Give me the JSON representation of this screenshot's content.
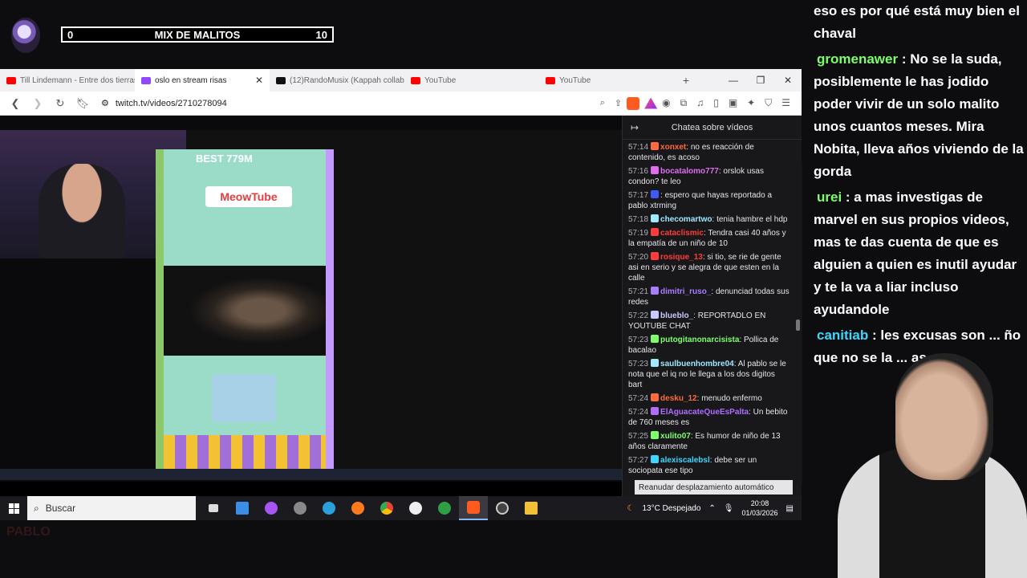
{
  "overlay": {
    "counter_left": "0",
    "counter_title": "MIX DE MALITOS",
    "counter_right": "10"
  },
  "browser": {
    "tabs": [
      {
        "label": "Till Lindemann - Entre dos tierras",
        "favicon_color": "#ff0000",
        "active": false
      },
      {
        "label": "oslo en stream risas",
        "favicon_color": "#9146ff",
        "active": true
      },
      {
        "label": "(12)RandoMusix (Kappah collab)",
        "favicon_color": "#111111",
        "active": false
      },
      {
        "label": "YouTube",
        "favicon_color": "#ff0000",
        "active": false
      },
      {
        "label": "YouTube",
        "favicon_color": "#ff0000",
        "active": false
      }
    ],
    "url": "twitch.tv/videos/2710278094",
    "brave_badge": "1"
  },
  "video": {
    "game_banner": "MeowTube",
    "game_best": "BEST 779M"
  },
  "chat_panel": {
    "title": "Chatea sobre vídeos",
    "resume_label": "Reanudar desplazamiento automático",
    "messages": [
      {
        "time": "57:14",
        "user": "xonxet",
        "color": "#ff6a3d",
        "text": "no es reacción de contenido, es acoso"
      },
      {
        "time": "57:16",
        "user": "bocatalomo777",
        "color": "#e06cf2",
        "text": "orslok usas condon? te leo"
      },
      {
        "time": "57:17",
        "user": "",
        "color": "#3d5afe",
        "text": "espero que hayas reportado a pablo xtrming"
      },
      {
        "time": "57:18",
        "user": "checomartwo",
        "color": "#a0e7ff",
        "text": "tenia hambre el hdp"
      },
      {
        "time": "57:19",
        "user": "cataclismic",
        "color": "#ff3b3b",
        "text": "Tendra casi 40 años y la empatía de un niño de 10"
      },
      {
        "time": "57:20",
        "user": "rosique_13",
        "color": "#ff3b3b",
        "text": "si tio, se rie de gente asi en serio y se alegra de que esten en la calle"
      },
      {
        "time": "57:21",
        "user": "dimitri_ruso_",
        "color": "#a97dff",
        "text": "denunciad todas sus redes"
      },
      {
        "time": "57:22",
        "user": "blueblo_",
        "color": "#c9c9ff",
        "text": "REPORTADLO EN YOUTUBE CHAT"
      },
      {
        "time": "57:23",
        "user": "putogitanonarcisista",
        "color": "#7dff6a",
        "text": "Pollica de bacalao"
      },
      {
        "time": "57:23",
        "user": "saulbuenhombre04",
        "color": "#a0e7ff",
        "text": "Al pablo se le nota que el iq no le llega a los dos digitos bart"
      },
      {
        "time": "57:24",
        "user": "desku_12",
        "color": "#ff6a3d",
        "text": "menudo enfermo"
      },
      {
        "time": "57:24",
        "user": "ElAguacateQueEsPalta",
        "color": "#b06cff",
        "text": "Un bebito de 760 meses es"
      },
      {
        "time": "57:25",
        "user": "xulito07",
        "color": "#7dff6a",
        "text": "Es humor de niño de 13 años claramente"
      },
      {
        "time": "57:27",
        "user": "alexiscalebsl",
        "color": "#3dd6ff",
        "text": "debe ser un sociopata ese tipo"
      }
    ]
  },
  "taskbar": {
    "search_placeholder": "Buscar",
    "weather": "13°C  Despejado",
    "time": "20:08",
    "date": "01/03/2026"
  },
  "big_chat": [
    {
      "user": "",
      "color": "#ffffff",
      "text": "eso es por qué está muy bien el chaval"
    },
    {
      "user": "gromenawer",
      "color": "#7dff6a",
      "text": "No se la suda, posiblemente le has jodido poder vivir de un solo malito unos cuantos meses. Mira Nobita, lleva años viviendo de la gorda"
    },
    {
      "user": "urei",
      "color": "#7dff6a",
      "text": "a mas investigas de marvel en sus propios videos, mas te das cuenta de que es alguien a quien es inutil ayudar y te la va a liar incluso ayudandole"
    },
    {
      "user": "canitiab",
      "color": "#3dd6ff",
      "text": "les excusas son ... ño que no se la ... as"
    }
  ],
  "logo_text": "PABLO"
}
